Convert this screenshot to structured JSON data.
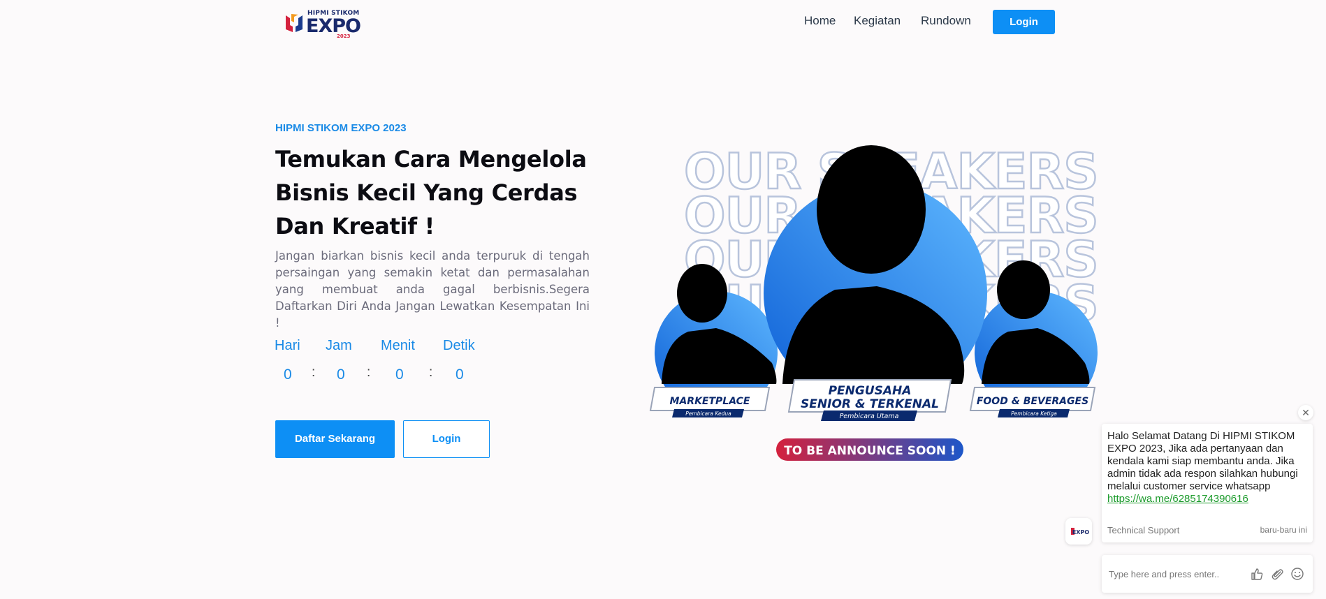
{
  "header": {
    "logo": {
      "top_text": "HIPMI STIKOM",
      "main_text": "EXPO",
      "year_text": "2023"
    },
    "nav": [
      {
        "label": "Home"
      },
      {
        "label": "Kegiatan"
      },
      {
        "label": "Rundown"
      }
    ],
    "login_label": "Login"
  },
  "hero": {
    "eyebrow": "HIPMI STIKOM EXPO 2023",
    "title": "Temukan Cara Mengelola Bisnis Kecil Yang Cerdas Dan Kreatif !",
    "description": "Jangan biarkan bisnis kecil anda terpuruk di tengah persaingan yang semakin ketat dan permasalahan yang membuat anda gagal berbisnis.Segera Daftarkan Diri Anda Jangan Lewatkan Kesempatan Ini !",
    "countdown": {
      "labels": [
        "Hari",
        "Jam",
        "Menit",
        "Detik"
      ],
      "values": [
        "0",
        "0",
        "0",
        "0"
      ],
      "separator": ":"
    },
    "primary_button": "Daftar Sekarang",
    "secondary_button": "Login"
  },
  "speakers": {
    "heading": "OUR SPEAKERS",
    "cards": [
      {
        "title": "MARKETPLACE",
        "subtitle": "Pembicara Kedua"
      },
      {
        "title_line1": "PENGUSAHA",
        "title_line2": "SENIOR & TERKENAL",
        "subtitle": "Pembicara Utama"
      },
      {
        "title": "FOOD & BEVERAGES",
        "subtitle": "Pembicara Ketiga"
      }
    ],
    "announce": "TO BE ANNOUNCE SOON !"
  },
  "chat": {
    "close": "✕",
    "message": "Halo Selamat Datang Di HIPMI STIKOM EXPO 2023, Jika ada pertanyaan dan kendala kami siap membantu anda. Jika admin tidak ada respon silahkan hubungi melalui customer service whatsapp",
    "link": "https://wa.me/6285174390616",
    "sender": "Technical Support",
    "time": "baru-baru ini",
    "avatar_text": "EXPO",
    "input_placeholder": "Type here and press enter.."
  },
  "colors": {
    "accent": "#0d8ff5",
    "accent_text": "#1a8ae6",
    "navy": "#1a2a6c",
    "announce_red": "#d4213d",
    "announce_blue": "#1d57c9"
  },
  "icons": [
    "thumbs-up-icon",
    "paperclip-icon",
    "smiley-icon",
    "close-icon"
  ]
}
